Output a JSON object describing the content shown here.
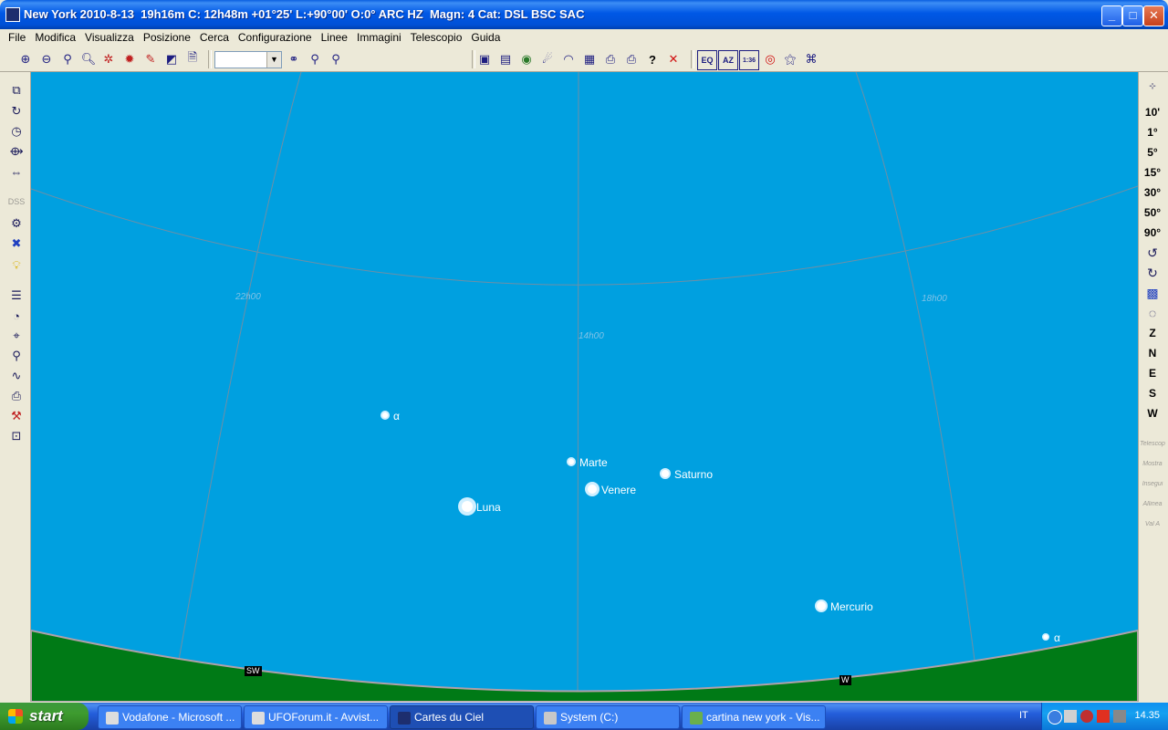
{
  "window": {
    "title": "New York 2010-8-13  19h16m C: 12h48m +01°25' L:+90°00' O:0° ARC HZ  Magn: 4 Cat: DSL BSC SAC",
    "minimize_label": "_",
    "maximize_label": "□",
    "close_label": "✕"
  },
  "menu": [
    "File",
    "Modifica",
    "Visualizza",
    "Posizione",
    "Cerca",
    "Configurazione",
    "Linee",
    "Immagini",
    "Telescopio",
    "Guida"
  ],
  "toolbar": {
    "fov_value": "",
    "buttons": [
      "zoom-in",
      "zoom-out",
      "zoom-window",
      "zoom-find",
      "planets",
      "sun",
      "objects",
      "invert-colors",
      "new-chart",
      "find-binoculars",
      "zoom-plus",
      "zoom-minus",
      "save",
      "notes",
      "earth",
      "comet",
      "observatory",
      "calendar",
      "print",
      "print-setup",
      "help",
      "close"
    ],
    "help_glyph": "?",
    "close_glyph": "✕",
    "eq_label": "EQ",
    "az_label": "AZ",
    "grid_label": "1:36"
  },
  "right_toolbar": {
    "fov_buttons": [
      "10'",
      "1°",
      "5°",
      "15°",
      "30°",
      "50°",
      "90°"
    ],
    "direction_buttons": [
      "Z",
      "N",
      "E",
      "S",
      "W"
    ],
    "dimmed_labels": [
      "Telescop",
      "Mostra",
      "Insegui",
      "Allinea",
      "Val A"
    ]
  },
  "sky": {
    "colors": {
      "sky": "#00a0e0",
      "ground": "#007a16",
      "grid": "#6e8fa6"
    },
    "grid_labels": [
      "22h00",
      "14h00",
      "18h00"
    ],
    "objects": [
      {
        "label": "α"
      },
      {
        "label": "Marte"
      },
      {
        "label": "Saturno"
      },
      {
        "label": "Venere"
      },
      {
        "label": "Luna"
      },
      {
        "label": "Mercurio"
      },
      {
        "label": "α"
      }
    ],
    "horizon_labels": [
      "SW",
      "W"
    ]
  },
  "taskbar": {
    "start_label": "start",
    "tasks": [
      {
        "label": "Vodafone - Microsoft ..."
      },
      {
        "label": "UFOForum.it - Avvist..."
      },
      {
        "label": "Cartes du Ciel"
      },
      {
        "label": "System (C:)"
      },
      {
        "label": "cartina new york - Vis..."
      }
    ],
    "language": "IT",
    "clock": "14.35"
  }
}
